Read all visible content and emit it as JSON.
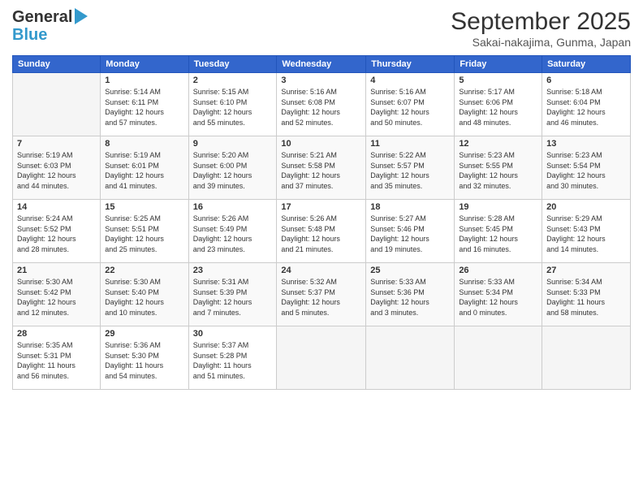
{
  "header": {
    "logo_line1": "General",
    "logo_line2": "Blue",
    "month_title": "September 2025",
    "location": "Sakai-nakajima, Gunma, Japan"
  },
  "days_of_week": [
    "Sunday",
    "Monday",
    "Tuesday",
    "Wednesday",
    "Thursday",
    "Friday",
    "Saturday"
  ],
  "weeks": [
    [
      {
        "day": "",
        "info": ""
      },
      {
        "day": "1",
        "info": "Sunrise: 5:14 AM\nSunset: 6:11 PM\nDaylight: 12 hours\nand 57 minutes."
      },
      {
        "day": "2",
        "info": "Sunrise: 5:15 AM\nSunset: 6:10 PM\nDaylight: 12 hours\nand 55 minutes."
      },
      {
        "day": "3",
        "info": "Sunrise: 5:16 AM\nSunset: 6:08 PM\nDaylight: 12 hours\nand 52 minutes."
      },
      {
        "day": "4",
        "info": "Sunrise: 5:16 AM\nSunset: 6:07 PM\nDaylight: 12 hours\nand 50 minutes."
      },
      {
        "day": "5",
        "info": "Sunrise: 5:17 AM\nSunset: 6:06 PM\nDaylight: 12 hours\nand 48 minutes."
      },
      {
        "day": "6",
        "info": "Sunrise: 5:18 AM\nSunset: 6:04 PM\nDaylight: 12 hours\nand 46 minutes."
      }
    ],
    [
      {
        "day": "7",
        "info": "Sunrise: 5:19 AM\nSunset: 6:03 PM\nDaylight: 12 hours\nand 44 minutes."
      },
      {
        "day": "8",
        "info": "Sunrise: 5:19 AM\nSunset: 6:01 PM\nDaylight: 12 hours\nand 41 minutes."
      },
      {
        "day": "9",
        "info": "Sunrise: 5:20 AM\nSunset: 6:00 PM\nDaylight: 12 hours\nand 39 minutes."
      },
      {
        "day": "10",
        "info": "Sunrise: 5:21 AM\nSunset: 5:58 PM\nDaylight: 12 hours\nand 37 minutes."
      },
      {
        "day": "11",
        "info": "Sunrise: 5:22 AM\nSunset: 5:57 PM\nDaylight: 12 hours\nand 35 minutes."
      },
      {
        "day": "12",
        "info": "Sunrise: 5:23 AM\nSunset: 5:55 PM\nDaylight: 12 hours\nand 32 minutes."
      },
      {
        "day": "13",
        "info": "Sunrise: 5:23 AM\nSunset: 5:54 PM\nDaylight: 12 hours\nand 30 minutes."
      }
    ],
    [
      {
        "day": "14",
        "info": "Sunrise: 5:24 AM\nSunset: 5:52 PM\nDaylight: 12 hours\nand 28 minutes."
      },
      {
        "day": "15",
        "info": "Sunrise: 5:25 AM\nSunset: 5:51 PM\nDaylight: 12 hours\nand 25 minutes."
      },
      {
        "day": "16",
        "info": "Sunrise: 5:26 AM\nSunset: 5:49 PM\nDaylight: 12 hours\nand 23 minutes."
      },
      {
        "day": "17",
        "info": "Sunrise: 5:26 AM\nSunset: 5:48 PM\nDaylight: 12 hours\nand 21 minutes."
      },
      {
        "day": "18",
        "info": "Sunrise: 5:27 AM\nSunset: 5:46 PM\nDaylight: 12 hours\nand 19 minutes."
      },
      {
        "day": "19",
        "info": "Sunrise: 5:28 AM\nSunset: 5:45 PM\nDaylight: 12 hours\nand 16 minutes."
      },
      {
        "day": "20",
        "info": "Sunrise: 5:29 AM\nSunset: 5:43 PM\nDaylight: 12 hours\nand 14 minutes."
      }
    ],
    [
      {
        "day": "21",
        "info": "Sunrise: 5:30 AM\nSunset: 5:42 PM\nDaylight: 12 hours\nand 12 minutes."
      },
      {
        "day": "22",
        "info": "Sunrise: 5:30 AM\nSunset: 5:40 PM\nDaylight: 12 hours\nand 10 minutes."
      },
      {
        "day": "23",
        "info": "Sunrise: 5:31 AM\nSunset: 5:39 PM\nDaylight: 12 hours\nand 7 minutes."
      },
      {
        "day": "24",
        "info": "Sunrise: 5:32 AM\nSunset: 5:37 PM\nDaylight: 12 hours\nand 5 minutes."
      },
      {
        "day": "25",
        "info": "Sunrise: 5:33 AM\nSunset: 5:36 PM\nDaylight: 12 hours\nand 3 minutes."
      },
      {
        "day": "26",
        "info": "Sunrise: 5:33 AM\nSunset: 5:34 PM\nDaylight: 12 hours\nand 0 minutes."
      },
      {
        "day": "27",
        "info": "Sunrise: 5:34 AM\nSunset: 5:33 PM\nDaylight: 11 hours\nand 58 minutes."
      }
    ],
    [
      {
        "day": "28",
        "info": "Sunrise: 5:35 AM\nSunset: 5:31 PM\nDaylight: 11 hours\nand 56 minutes."
      },
      {
        "day": "29",
        "info": "Sunrise: 5:36 AM\nSunset: 5:30 PM\nDaylight: 11 hours\nand 54 minutes."
      },
      {
        "day": "30",
        "info": "Sunrise: 5:37 AM\nSunset: 5:28 PM\nDaylight: 11 hours\nand 51 minutes."
      },
      {
        "day": "",
        "info": ""
      },
      {
        "day": "",
        "info": ""
      },
      {
        "day": "",
        "info": ""
      },
      {
        "day": "",
        "info": ""
      }
    ]
  ]
}
